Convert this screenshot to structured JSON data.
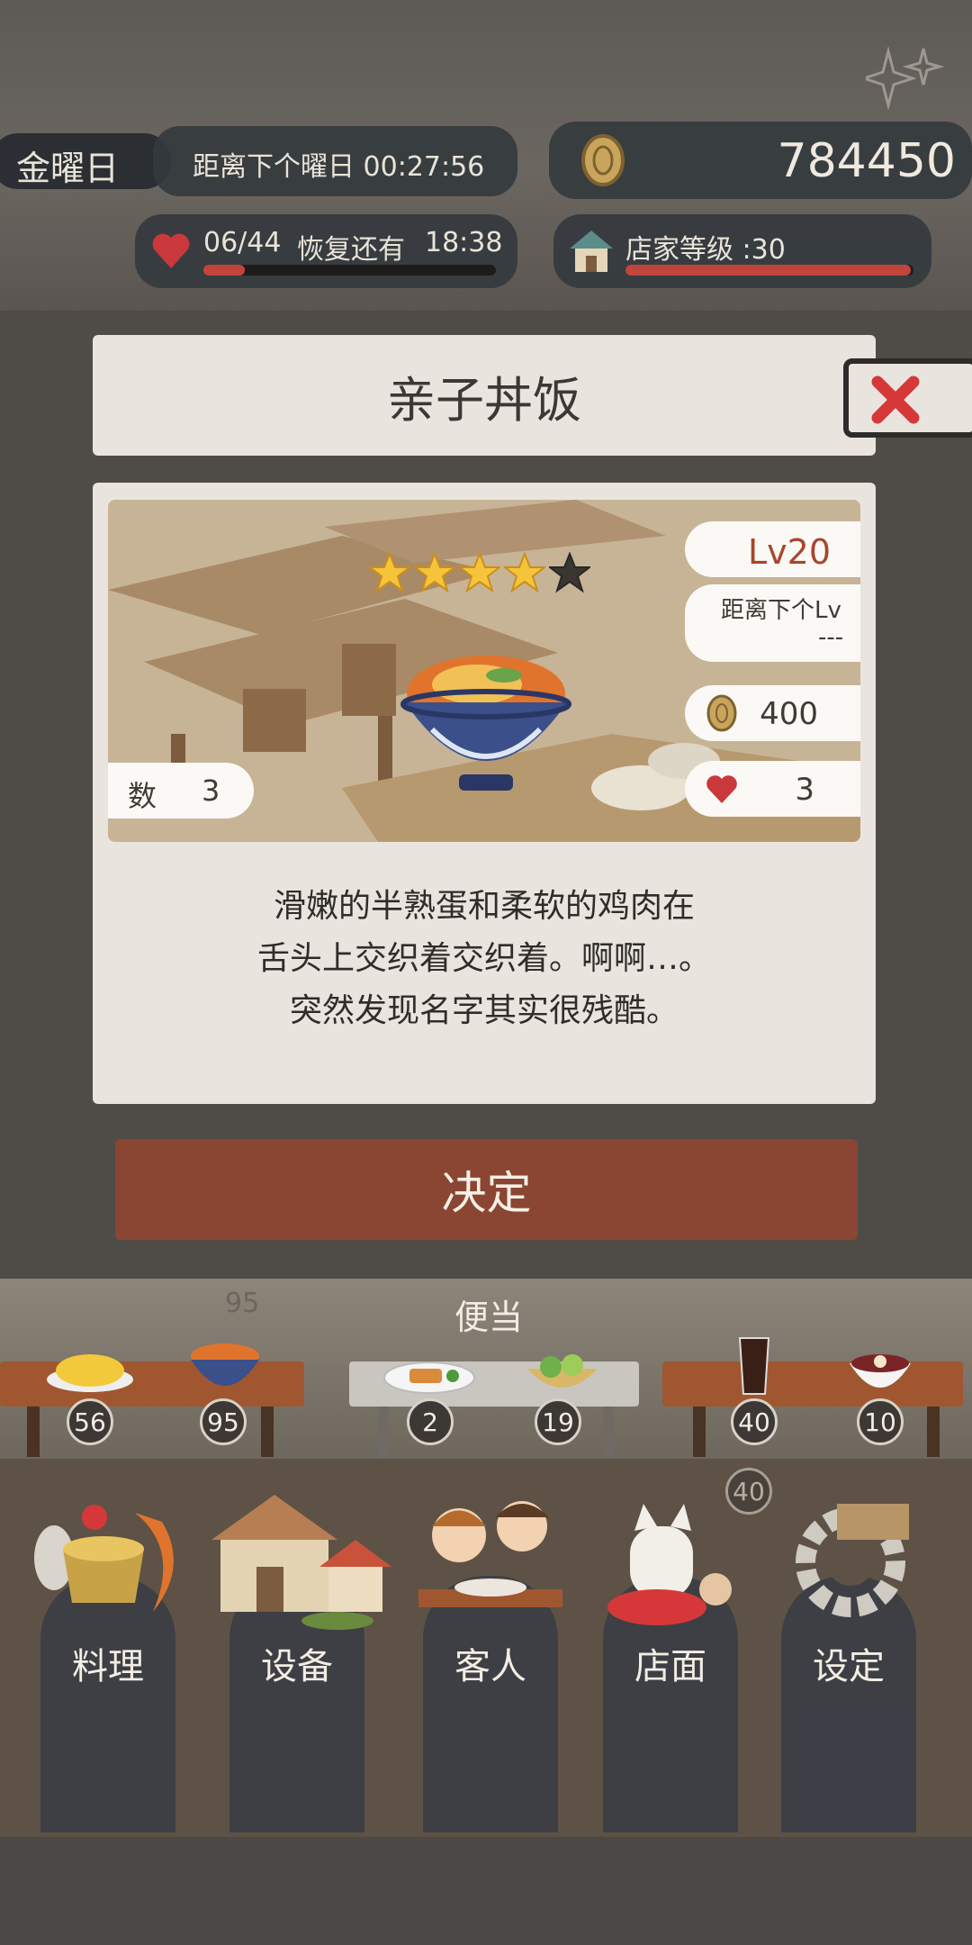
{
  "status_bar": {
    "weekday": "金曜日",
    "countdown_label": "距离下个曜日 00:27:56",
    "coins": "784450",
    "stamina": "06/44",
    "stamina_recover": "恢复还有",
    "stamina_timer": "18:38",
    "stamina_fraction": 0.14,
    "shop_level": "店家等级 :30",
    "shop_level_fraction": 0.99
  },
  "dish_dialog": {
    "title": "亲子丼饭",
    "rating": 4,
    "rating_max": 5,
    "level": "Lv20",
    "next_level_label": "距离下个Lv",
    "next_level_value": "---",
    "price": "400",
    "hearts": "3",
    "count_label": "数",
    "count_value": "3",
    "description_lines": [
      "滑嫩的半熟蛋和柔软的鸡肉在",
      "舌头上交织着交织着。啊啊…。",
      "突然发现名字其实很残酷。"
    ],
    "confirm_label": "决定"
  },
  "shelves": {
    "category_label": "便当",
    "faded_count": "95",
    "items": [
      {
        "name": "omelet-rice",
        "count": "56"
      },
      {
        "name": "oyakodon",
        "count": "95"
      },
      {
        "name": "fried-fish-plate",
        "count": "2"
      },
      {
        "name": "salad",
        "count": "19"
      },
      {
        "name": "iced-coffee",
        "count": "40"
      },
      {
        "name": "red-bean-soup",
        "count": "10"
      }
    ],
    "ghost_count": "40"
  },
  "bottom_menu": {
    "items": [
      "料理",
      "设备",
      "客人",
      "店面",
      "设定"
    ]
  },
  "colors": {
    "accent_red": "#c2453d",
    "confirm_brown": "#8a4632",
    "level_text": "#a8462c"
  }
}
